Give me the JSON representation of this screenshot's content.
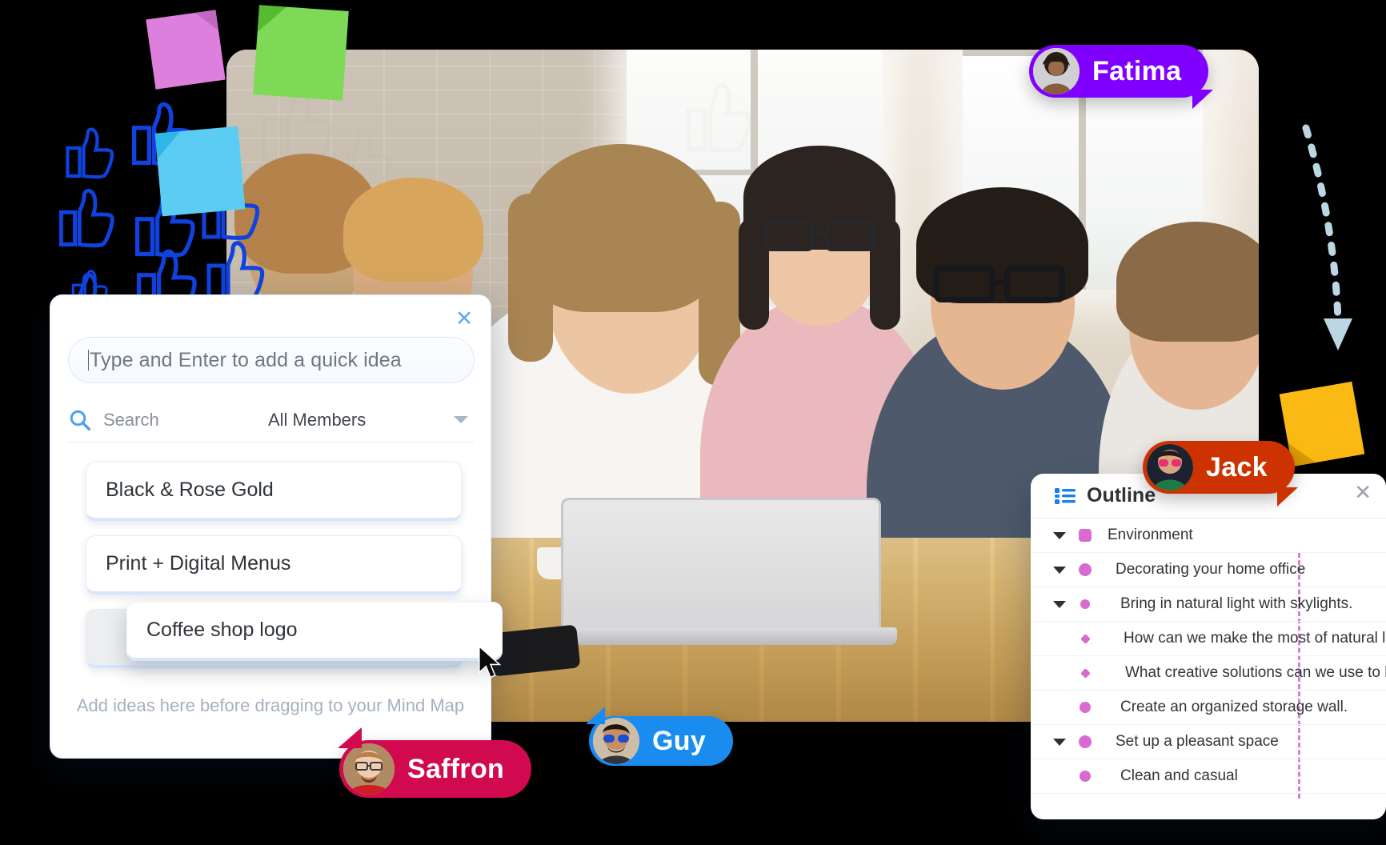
{
  "quick_idea_panel": {
    "close_icon": "close-icon",
    "input_placeholder": "Type and Enter to add a quick idea",
    "input_value": "",
    "search_icon": "search-icon",
    "search_label": "Search",
    "members_filter": "All Members",
    "members_caret": "chevron-down-icon",
    "cards": [
      {
        "label": "Black & Rose Gold"
      },
      {
        "label": "Print + Digital Menus"
      },
      {
        "label": ""
      }
    ],
    "dragging_card": "Coffee shop logo",
    "hint": "Add ideas here before dragging to your Mind Map"
  },
  "outline_panel": {
    "icon": "outline-list-icon",
    "title": "Outline",
    "close_icon": "close-icon",
    "accent_color": "#d86ad0",
    "rows": [
      {
        "label": "Environment",
        "depth": 0,
        "twisty": true,
        "marker": "square"
      },
      {
        "label": "Decorating your home office",
        "depth": 1,
        "twisty": true,
        "marker": "dot"
      },
      {
        "label": "Bring in natural light with skylights.",
        "depth": 2,
        "twisty": true,
        "marker": "dot-sm"
      },
      {
        "label": "How can we make the most of natural light?",
        "depth": 3,
        "twisty": false,
        "marker": "diamond"
      },
      {
        "label": "What creative solutions can we use to bright…",
        "depth": 3,
        "twisty": false,
        "marker": "diamond"
      },
      {
        "label": "Create an organized storage wall.",
        "depth": 2,
        "twisty": false,
        "marker": "dot"
      },
      {
        "label": "Set up a pleasant space",
        "depth": 1,
        "twisty": true,
        "marker": "dot"
      },
      {
        "label": "Clean and casual",
        "depth": 2,
        "twisty": false,
        "marker": "dot"
      }
    ]
  },
  "collaborators": [
    {
      "name": "Fatima",
      "color": "#8000ff"
    },
    {
      "name": "Jack",
      "color": "#cc3300"
    },
    {
      "name": "Guy",
      "color": "#1a8cf0"
    },
    {
      "name": "Saffron",
      "color": "#d1094f"
    }
  ],
  "sticky_notes": [
    {
      "name": "sticky-note-pink",
      "color": "#dd7fdc"
    },
    {
      "name": "sticky-note-green",
      "color": "#7ed957"
    },
    {
      "name": "sticky-note-blue",
      "color": "#5ccdf2"
    },
    {
      "name": "sticky-note-yellow",
      "color": "#fbb913"
    }
  ],
  "decor": {
    "thumbs_up_color": "#1042e0",
    "arrow_color": "#bcd6e4",
    "arrow_name": "dashed-arrow-icon"
  }
}
